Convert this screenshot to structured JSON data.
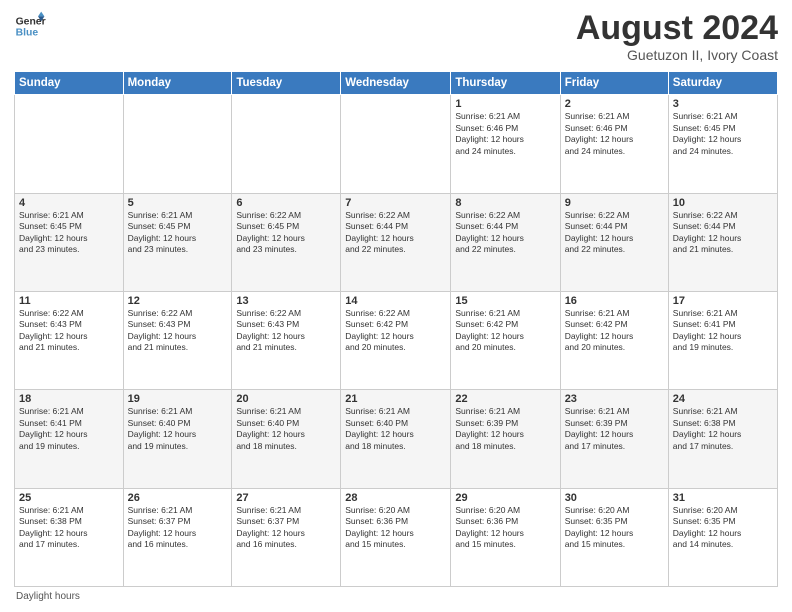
{
  "header": {
    "logo_line1": "General",
    "logo_line2": "Blue",
    "month": "August 2024",
    "location": "Guetuzon II, Ivory Coast"
  },
  "days_of_week": [
    "Sunday",
    "Monday",
    "Tuesday",
    "Wednesday",
    "Thursday",
    "Friday",
    "Saturday"
  ],
  "weeks": [
    [
      {
        "day": "",
        "info": ""
      },
      {
        "day": "",
        "info": ""
      },
      {
        "day": "",
        "info": ""
      },
      {
        "day": "",
        "info": ""
      },
      {
        "day": "1",
        "info": "Sunrise: 6:21 AM\nSunset: 6:46 PM\nDaylight: 12 hours\nand 24 minutes."
      },
      {
        "day": "2",
        "info": "Sunrise: 6:21 AM\nSunset: 6:46 PM\nDaylight: 12 hours\nand 24 minutes."
      },
      {
        "day": "3",
        "info": "Sunrise: 6:21 AM\nSunset: 6:45 PM\nDaylight: 12 hours\nand 24 minutes."
      }
    ],
    [
      {
        "day": "4",
        "info": "Sunrise: 6:21 AM\nSunset: 6:45 PM\nDaylight: 12 hours\nand 23 minutes."
      },
      {
        "day": "5",
        "info": "Sunrise: 6:21 AM\nSunset: 6:45 PM\nDaylight: 12 hours\nand 23 minutes."
      },
      {
        "day": "6",
        "info": "Sunrise: 6:22 AM\nSunset: 6:45 PM\nDaylight: 12 hours\nand 23 minutes."
      },
      {
        "day": "7",
        "info": "Sunrise: 6:22 AM\nSunset: 6:44 PM\nDaylight: 12 hours\nand 22 minutes."
      },
      {
        "day": "8",
        "info": "Sunrise: 6:22 AM\nSunset: 6:44 PM\nDaylight: 12 hours\nand 22 minutes."
      },
      {
        "day": "9",
        "info": "Sunrise: 6:22 AM\nSunset: 6:44 PM\nDaylight: 12 hours\nand 22 minutes."
      },
      {
        "day": "10",
        "info": "Sunrise: 6:22 AM\nSunset: 6:44 PM\nDaylight: 12 hours\nand 21 minutes."
      }
    ],
    [
      {
        "day": "11",
        "info": "Sunrise: 6:22 AM\nSunset: 6:43 PM\nDaylight: 12 hours\nand 21 minutes."
      },
      {
        "day": "12",
        "info": "Sunrise: 6:22 AM\nSunset: 6:43 PM\nDaylight: 12 hours\nand 21 minutes."
      },
      {
        "day": "13",
        "info": "Sunrise: 6:22 AM\nSunset: 6:43 PM\nDaylight: 12 hours\nand 21 minutes."
      },
      {
        "day": "14",
        "info": "Sunrise: 6:22 AM\nSunset: 6:42 PM\nDaylight: 12 hours\nand 20 minutes."
      },
      {
        "day": "15",
        "info": "Sunrise: 6:21 AM\nSunset: 6:42 PM\nDaylight: 12 hours\nand 20 minutes."
      },
      {
        "day": "16",
        "info": "Sunrise: 6:21 AM\nSunset: 6:42 PM\nDaylight: 12 hours\nand 20 minutes."
      },
      {
        "day": "17",
        "info": "Sunrise: 6:21 AM\nSunset: 6:41 PM\nDaylight: 12 hours\nand 19 minutes."
      }
    ],
    [
      {
        "day": "18",
        "info": "Sunrise: 6:21 AM\nSunset: 6:41 PM\nDaylight: 12 hours\nand 19 minutes."
      },
      {
        "day": "19",
        "info": "Sunrise: 6:21 AM\nSunset: 6:40 PM\nDaylight: 12 hours\nand 19 minutes."
      },
      {
        "day": "20",
        "info": "Sunrise: 6:21 AM\nSunset: 6:40 PM\nDaylight: 12 hours\nand 18 minutes."
      },
      {
        "day": "21",
        "info": "Sunrise: 6:21 AM\nSunset: 6:40 PM\nDaylight: 12 hours\nand 18 minutes."
      },
      {
        "day": "22",
        "info": "Sunrise: 6:21 AM\nSunset: 6:39 PM\nDaylight: 12 hours\nand 18 minutes."
      },
      {
        "day": "23",
        "info": "Sunrise: 6:21 AM\nSunset: 6:39 PM\nDaylight: 12 hours\nand 17 minutes."
      },
      {
        "day": "24",
        "info": "Sunrise: 6:21 AM\nSunset: 6:38 PM\nDaylight: 12 hours\nand 17 minutes."
      }
    ],
    [
      {
        "day": "25",
        "info": "Sunrise: 6:21 AM\nSunset: 6:38 PM\nDaylight: 12 hours\nand 17 minutes."
      },
      {
        "day": "26",
        "info": "Sunrise: 6:21 AM\nSunset: 6:37 PM\nDaylight: 12 hours\nand 16 minutes."
      },
      {
        "day": "27",
        "info": "Sunrise: 6:21 AM\nSunset: 6:37 PM\nDaylight: 12 hours\nand 16 minutes."
      },
      {
        "day": "28",
        "info": "Sunrise: 6:20 AM\nSunset: 6:36 PM\nDaylight: 12 hours\nand 15 minutes."
      },
      {
        "day": "29",
        "info": "Sunrise: 6:20 AM\nSunset: 6:36 PM\nDaylight: 12 hours\nand 15 minutes."
      },
      {
        "day": "30",
        "info": "Sunrise: 6:20 AM\nSunset: 6:35 PM\nDaylight: 12 hours\nand 15 minutes."
      },
      {
        "day": "31",
        "info": "Sunrise: 6:20 AM\nSunset: 6:35 PM\nDaylight: 12 hours\nand 14 minutes."
      }
    ]
  ],
  "footer": {
    "note": "Daylight hours"
  }
}
